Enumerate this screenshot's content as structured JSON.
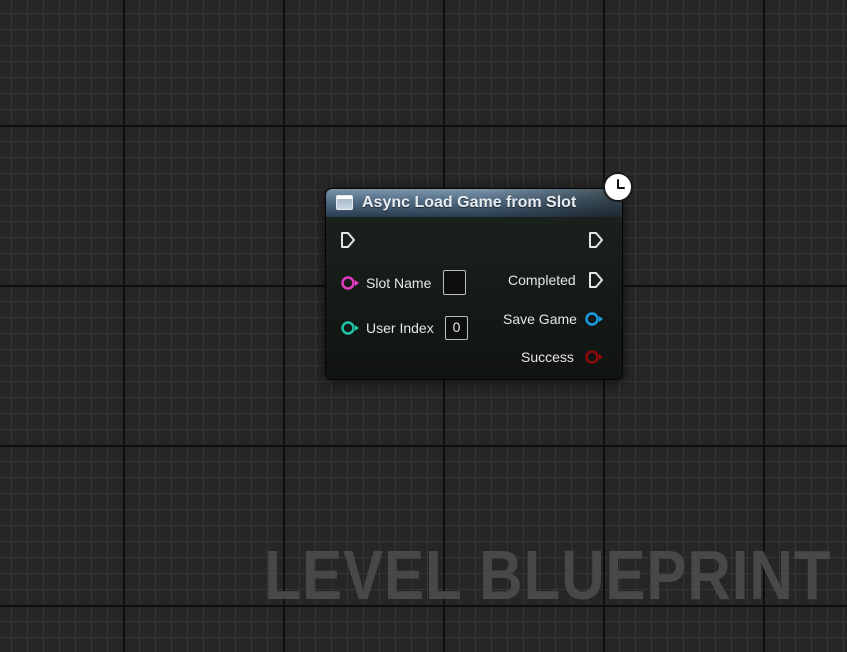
{
  "node": {
    "title": "Async Load Game from Slot",
    "header_icon": "function-icon",
    "latent_icon": "clock-icon",
    "header_color": "#5a748c"
  },
  "inputs": [
    {
      "label": "Slot Name",
      "type": "string",
      "color": "#e33ac0",
      "value": ""
    },
    {
      "label": "User Index",
      "type": "integer",
      "color": "#1ec4a4",
      "value": "0"
    }
  ],
  "outputs": [
    {
      "label": "Completed",
      "type": "exec"
    },
    {
      "label": "Save Game",
      "type": "object",
      "color": "#1a9ce0"
    },
    {
      "label": "Success",
      "type": "boolean",
      "color": "#8c0a0a"
    }
  ],
  "watermark": "LEVEL BLUEPRINT"
}
